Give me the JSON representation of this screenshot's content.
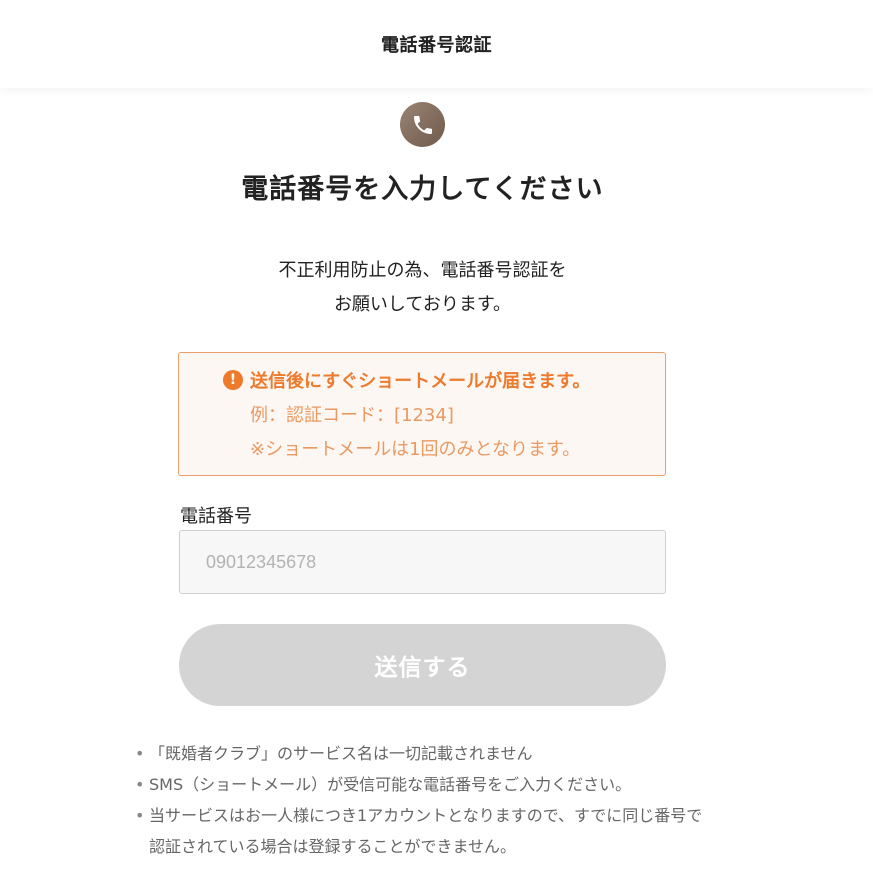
{
  "header": {
    "title": "電話番号認証"
  },
  "hero": {
    "icon": "phone-icon",
    "title": "電話番号を入力してください"
  },
  "lead": {
    "line1": "不正利用防止の為、電話番号認証を",
    "line2": "お願いしております。"
  },
  "notice": {
    "icon": "exclamation-icon",
    "icon_glyph": "!",
    "title": "送信後にすぐショートメールが届きます。",
    "line1": "例：認証コード：[1234]",
    "line2": "※ショートメールは1回のみとなります。"
  },
  "form": {
    "phone_label": "電話番号",
    "phone_placeholder": "09012345678",
    "phone_value": "",
    "submit_label": "送信する"
  },
  "notes": [
    {
      "bullet": "•",
      "text": "「既婚者クラブ」のサービス名は一切記載されません"
    },
    {
      "bullet": "•",
      "text": "SMS（ショートメール）が受信可能な電話番号をご入力ください。"
    },
    {
      "bullet": "•",
      "text": "当サービスはお一人様につき1アカウントとなりますので、すでに同じ番号で認証されている場合は登録することができません。"
    }
  ],
  "colors": {
    "accent_orange": "#ec7b2e",
    "notice_border": "#e9a06a",
    "notice_bg": "#fdf7f3",
    "badge_brown": "#7f6a5b",
    "button_disabled": "#d4d4d4"
  }
}
